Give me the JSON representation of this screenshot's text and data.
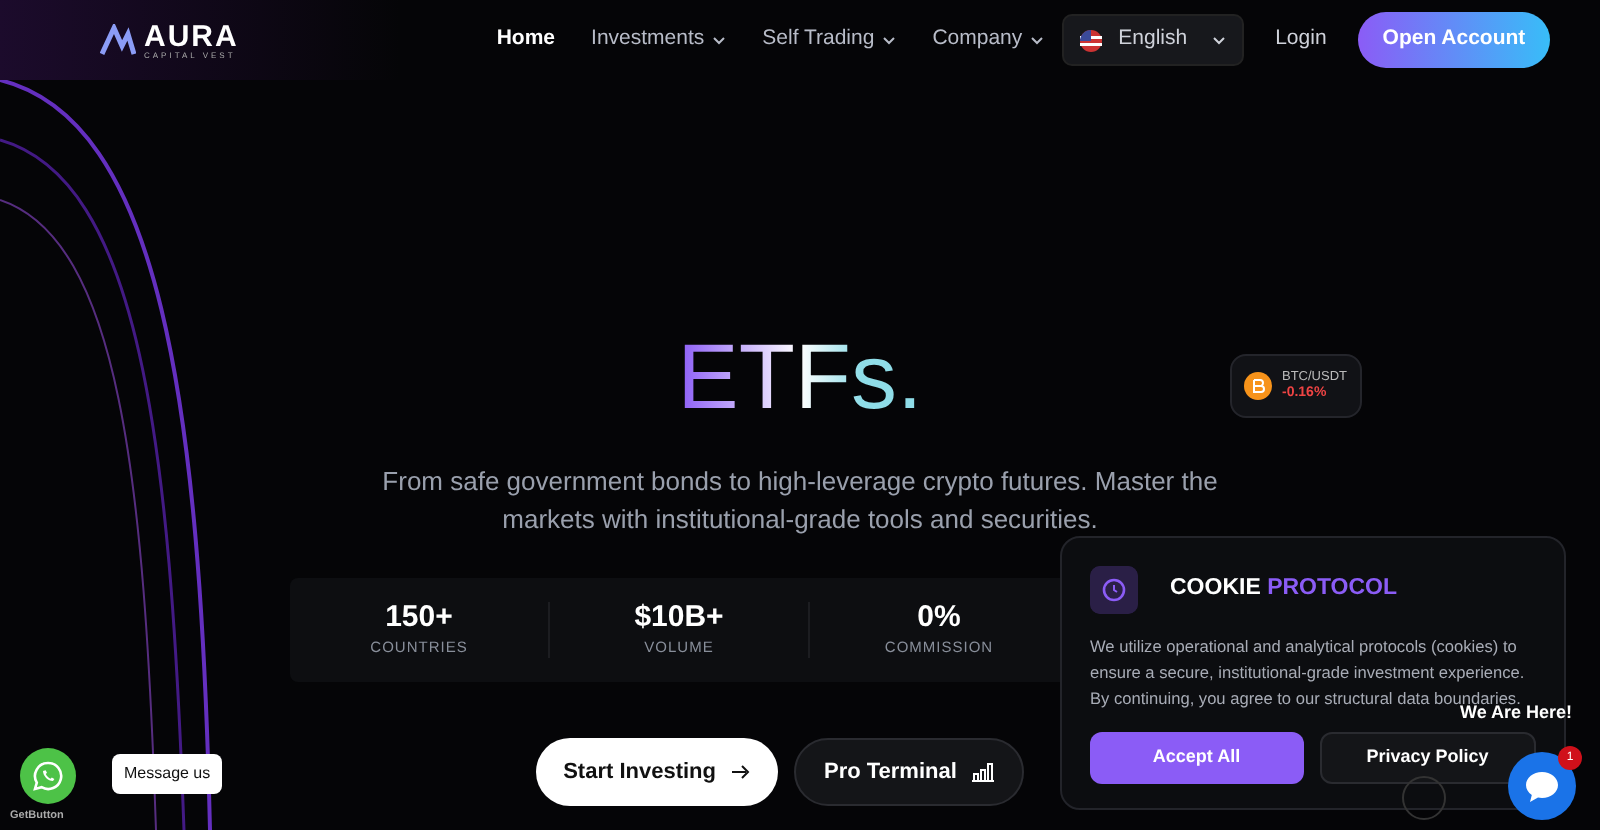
{
  "nav": {
    "logo": {
      "name": "AURA",
      "tagline": "CAPITAL VEST"
    },
    "links": [
      {
        "label": "Home",
        "selected": true,
        "dropdown": false
      },
      {
        "label": "Investments",
        "selected": false,
        "dropdown": true
      },
      {
        "label": "Self Trading",
        "selected": false,
        "dropdown": true
      },
      {
        "label": "Company",
        "selected": false,
        "dropdown": true
      }
    ],
    "language": "English",
    "login": "Login",
    "cta": "Open Account"
  },
  "hero": {
    "title": "ETFs.",
    "subtitle": "From safe government bonds to high-leverage crypto futures. Master the markets with institutional-grade tools and securities.",
    "stats": [
      {
        "value": "150+",
        "label": "COUNTRIES"
      },
      {
        "value": "$10B+",
        "label": "VOLUME"
      },
      {
        "value": "0%",
        "label": "COMMISSION"
      }
    ],
    "buttons": [
      {
        "label": "Start Investing",
        "kind": "primary"
      },
      {
        "label": "Pro Terminal",
        "kind": "secondary"
      }
    ]
  },
  "ticker": {
    "pair": "BTC/USDT",
    "change": "-0.16%"
  },
  "cookie": {
    "title": "COOKIE",
    "title_accent": "PROTOCOL",
    "text": "We utilize operational and analytical protocols (cookies) to ensure a secure, institutional-grade investment experience. By continuing, you agree to our structural data boundaries.",
    "buttons": [
      {
        "label": "Accept All",
        "kind": "primary"
      },
      {
        "label": "Privacy Policy",
        "kind": "secondary"
      }
    ]
  },
  "whatsapp": {
    "tooltip": "Message us",
    "brand": "GetButton"
  },
  "chat": {
    "label": "We Are Here!",
    "badge": "1"
  }
}
